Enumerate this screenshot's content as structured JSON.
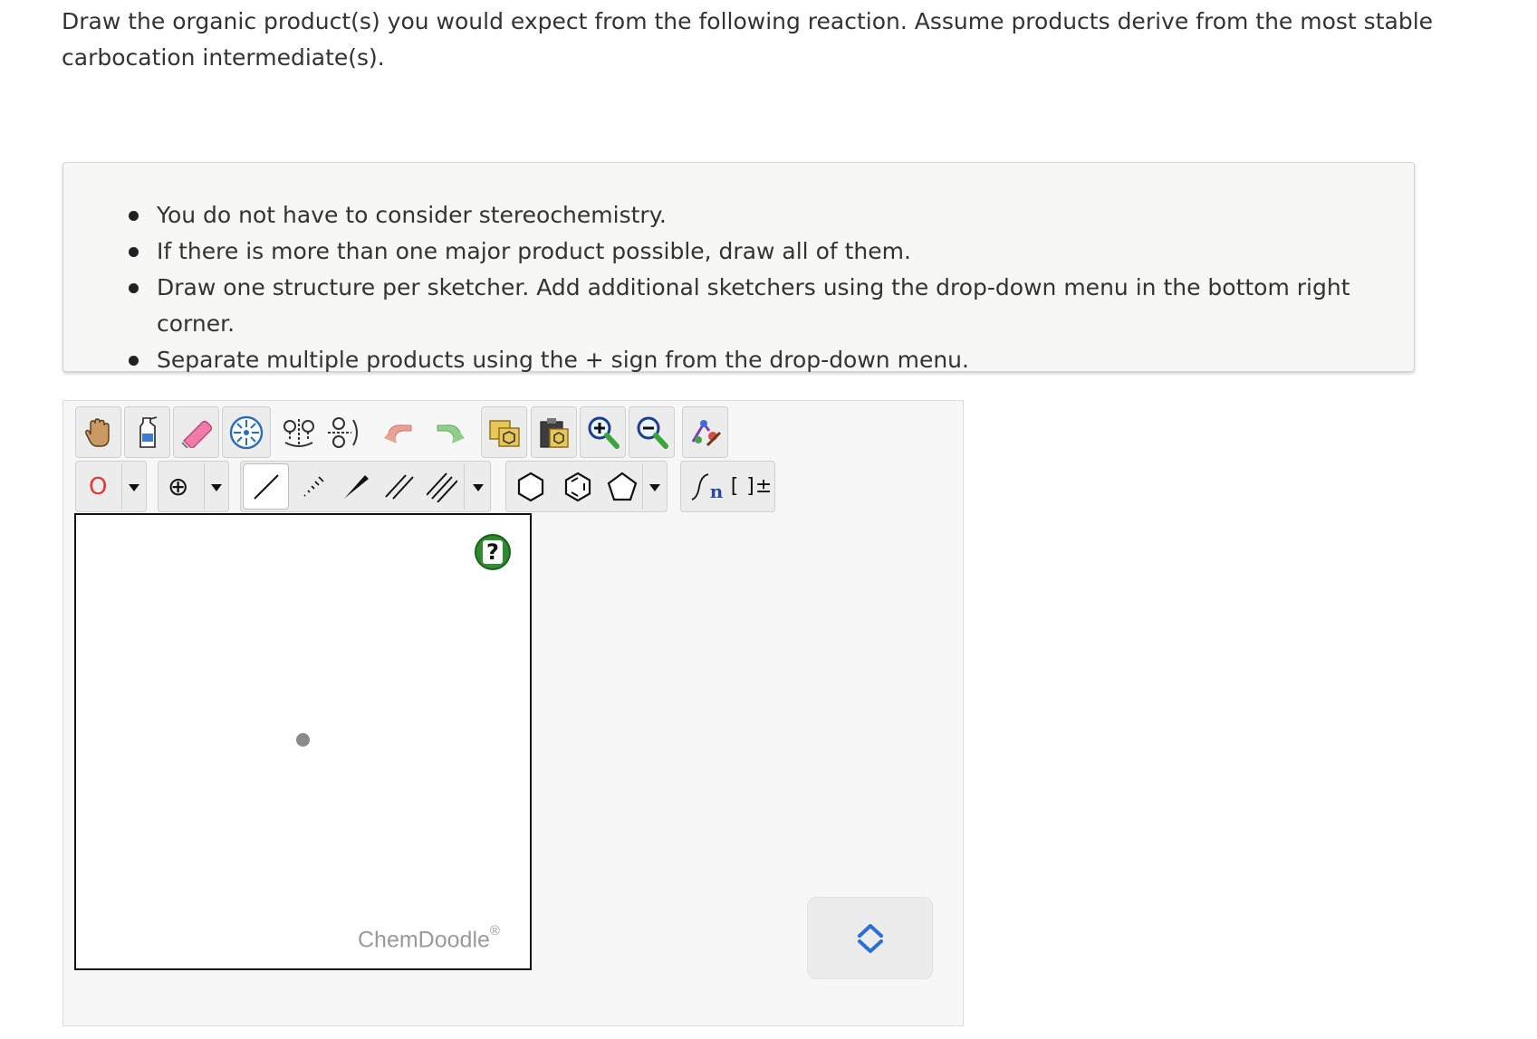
{
  "question": {
    "text": "Draw the organic product(s) you would expect from the following reaction. Assume products derive from the most stable carbocation intermediate(s)."
  },
  "instructions": {
    "items": [
      "You do not have to consider stereochemistry.",
      "If there is more than one major product possible, draw all of them.",
      "Draw one structure per sketcher. Add additional sketchers using the drop-down menu in the bottom right corner.",
      "Separate multiple products using the + sign from the drop-down menu."
    ]
  },
  "sketcher": {
    "toolbar_row1": [
      "hand-pan-icon",
      "clear-bottle-icon",
      "eraser-icon",
      "center-icon",
      "flip-horizontal-icon",
      "flip-vertical-icon",
      "undo-icon",
      "redo-icon",
      "copy-icon",
      "paste-icon",
      "zoom-in-icon",
      "zoom-out-icon",
      "clean-icon"
    ],
    "atom_label": "O",
    "charge_label": "⊕",
    "polymer_label": "n",
    "bracket_label": "[ ]±",
    "help_label": "?",
    "brand_name": "ChemDoodle",
    "brand_mark": "®",
    "colors": {
      "atom": "#e53935",
      "accent": "#2b6fd6",
      "help": "#2e8b2e"
    }
  }
}
